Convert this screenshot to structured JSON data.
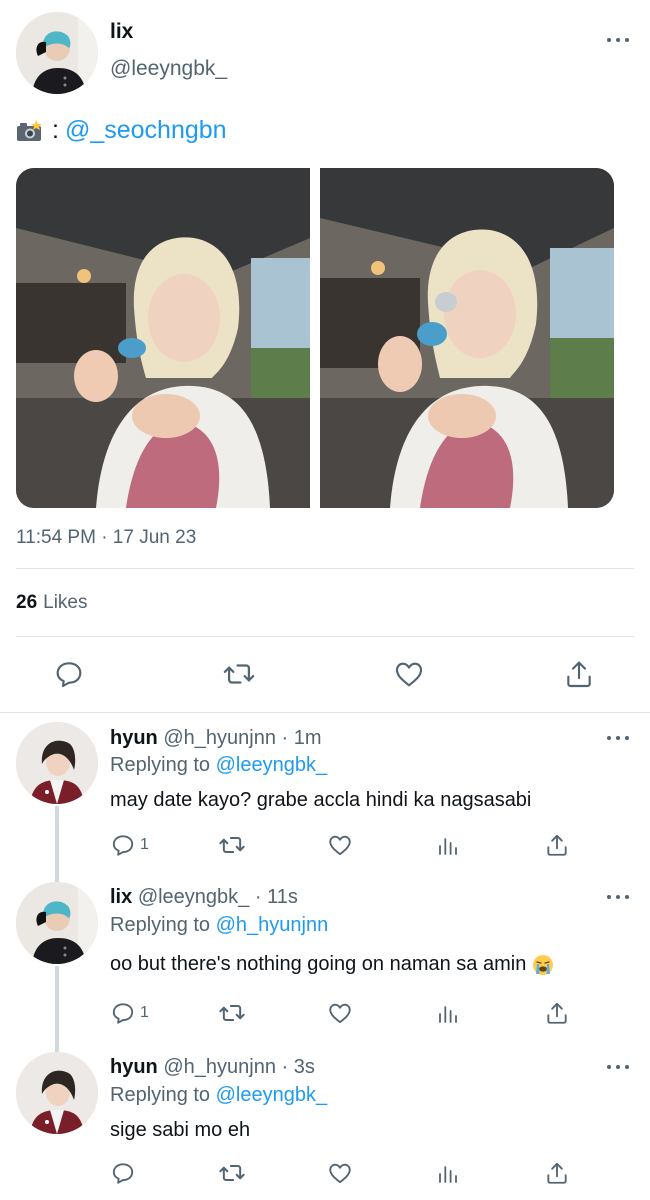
{
  "tweet": {
    "name": "lix",
    "handle": "@leeyngbk_",
    "camera_icon": "camera-flash-icon",
    "colon": ":",
    "mention": "@_seochngbn",
    "timestamp": "11:54 PM · 17 Jun 23",
    "likes_count": "26",
    "likes_label": "Likes"
  },
  "replies": [
    {
      "name": "hyun",
      "handle": "@h_hyunjnn",
      "time": "· 1m",
      "replying_prefix": "Replying to",
      "replying_to": "@leeyngbk_",
      "text": "may date kayo? grabe accla hindi ka nagsasabi",
      "reply_count": "1"
    },
    {
      "name": "lix",
      "handle": "@leeyngbk_",
      "time": "· 11s",
      "replying_prefix": "Replying to",
      "replying_to": "@h_hyunjnn",
      "text": "oo but there's nothing going on naman sa amin",
      "reply_count": "1"
    },
    {
      "name": "hyun",
      "handle": "@h_hyunjnn",
      "time": "· 3s",
      "replying_prefix": "Replying to",
      "replying_to": "@leeyngbk_",
      "text": "sige sabi mo eh",
      "reply_count": ""
    }
  ],
  "colors": {
    "link_blue": "#1d9bf0",
    "secondary_gray": "#536471",
    "divider": "#e3e6e8"
  }
}
